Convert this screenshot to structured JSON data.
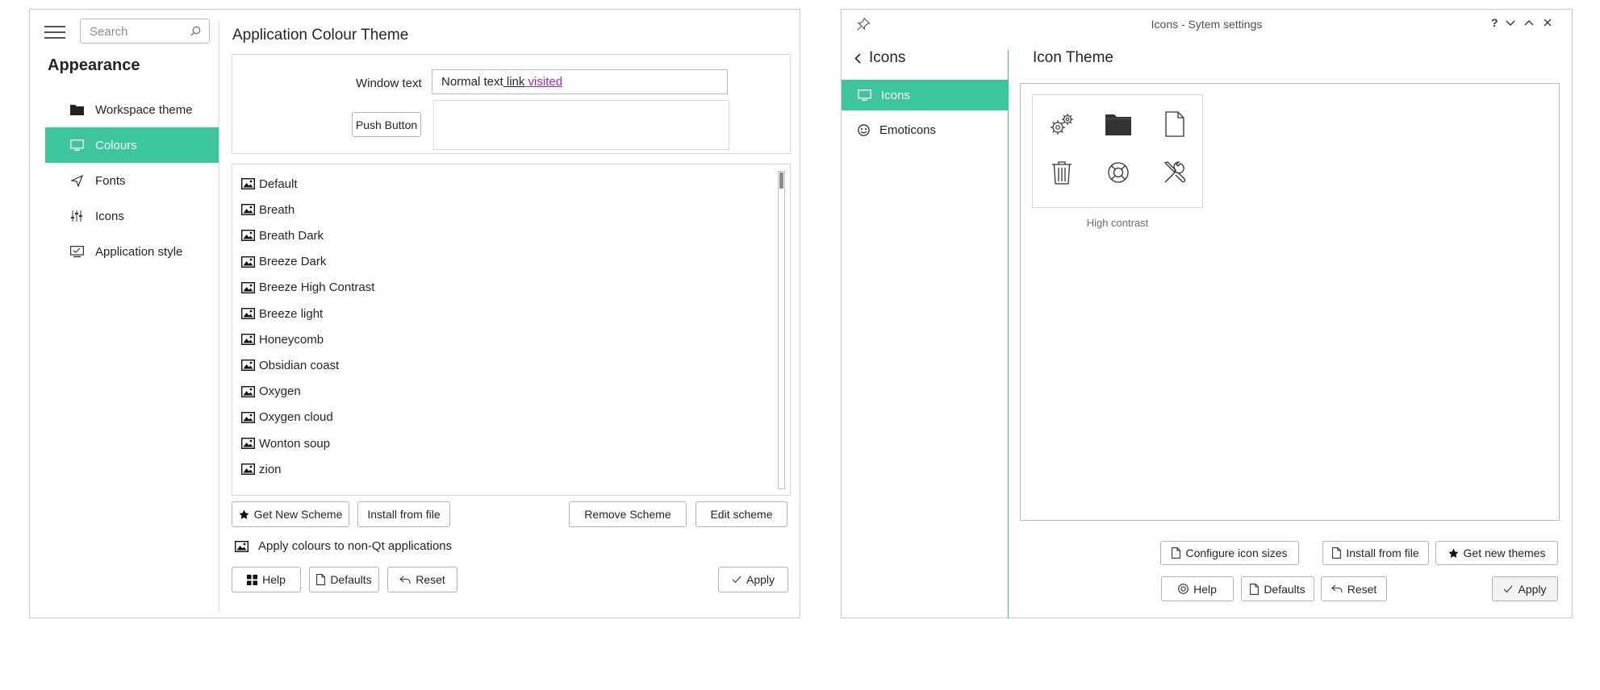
{
  "left": {
    "search": {
      "placeholder": "Search"
    },
    "sidebar": {
      "title": "Appearance",
      "items": [
        {
          "label": "Workspace theme",
          "icon": "folder-icon"
        },
        {
          "label": "Colours",
          "icon": "monitor-icon",
          "active": true
        },
        {
          "label": "Fonts",
          "icon": "send-icon"
        },
        {
          "label": "Icons",
          "icon": "sliders-icon"
        },
        {
          "label": "Application style",
          "icon": "desktop-settings-icon"
        }
      ]
    },
    "page_title": "Application Colour Theme",
    "preview": {
      "window_text_label": "Window text",
      "normal_text": "Normal text",
      "link_text": " link",
      "visited_text": " visited ",
      "push_button": "Push Button"
    },
    "schemes": [
      "Default",
      "Breath",
      "Breath Dark",
      "Breeze Dark",
      "Breeze High Contrast",
      "Breeze light",
      "Honeycomb",
      "Obsidian coast",
      "Oxygen",
      "Oxygen cloud",
      "Wonton soup",
      "zion"
    ],
    "buttons": {
      "get_new": "Get New Scheme",
      "install": "Install from file",
      "remove": "Remove Scheme",
      "edit": "Edit scheme",
      "help": "Help",
      "defaults": "Defaults",
      "reset": "Reset",
      "apply": "Apply"
    },
    "apply_colours": "Apply colours to non-Qt applications"
  },
  "right": {
    "title": "Icons - Sytem settings",
    "back_label": "Icons",
    "sidebar_items": [
      {
        "label": "Icons",
        "icon": "monitor-icon",
        "active": true
      },
      {
        "label": "Emoticons",
        "icon": "smiley-icon"
      }
    ],
    "page_title": "Icon Theme",
    "theme_name": "High contrast",
    "buttons": {
      "configure": "Configure icon sizes",
      "install": "Install from file",
      "get_new": "Get new themes",
      "help": "Help",
      "defaults": "Defaults",
      "reset": "Reset",
      "apply": "Apply"
    }
  },
  "colors": {
    "accent": "#3dc59c",
    "visited_link": "#9b2ab8"
  }
}
